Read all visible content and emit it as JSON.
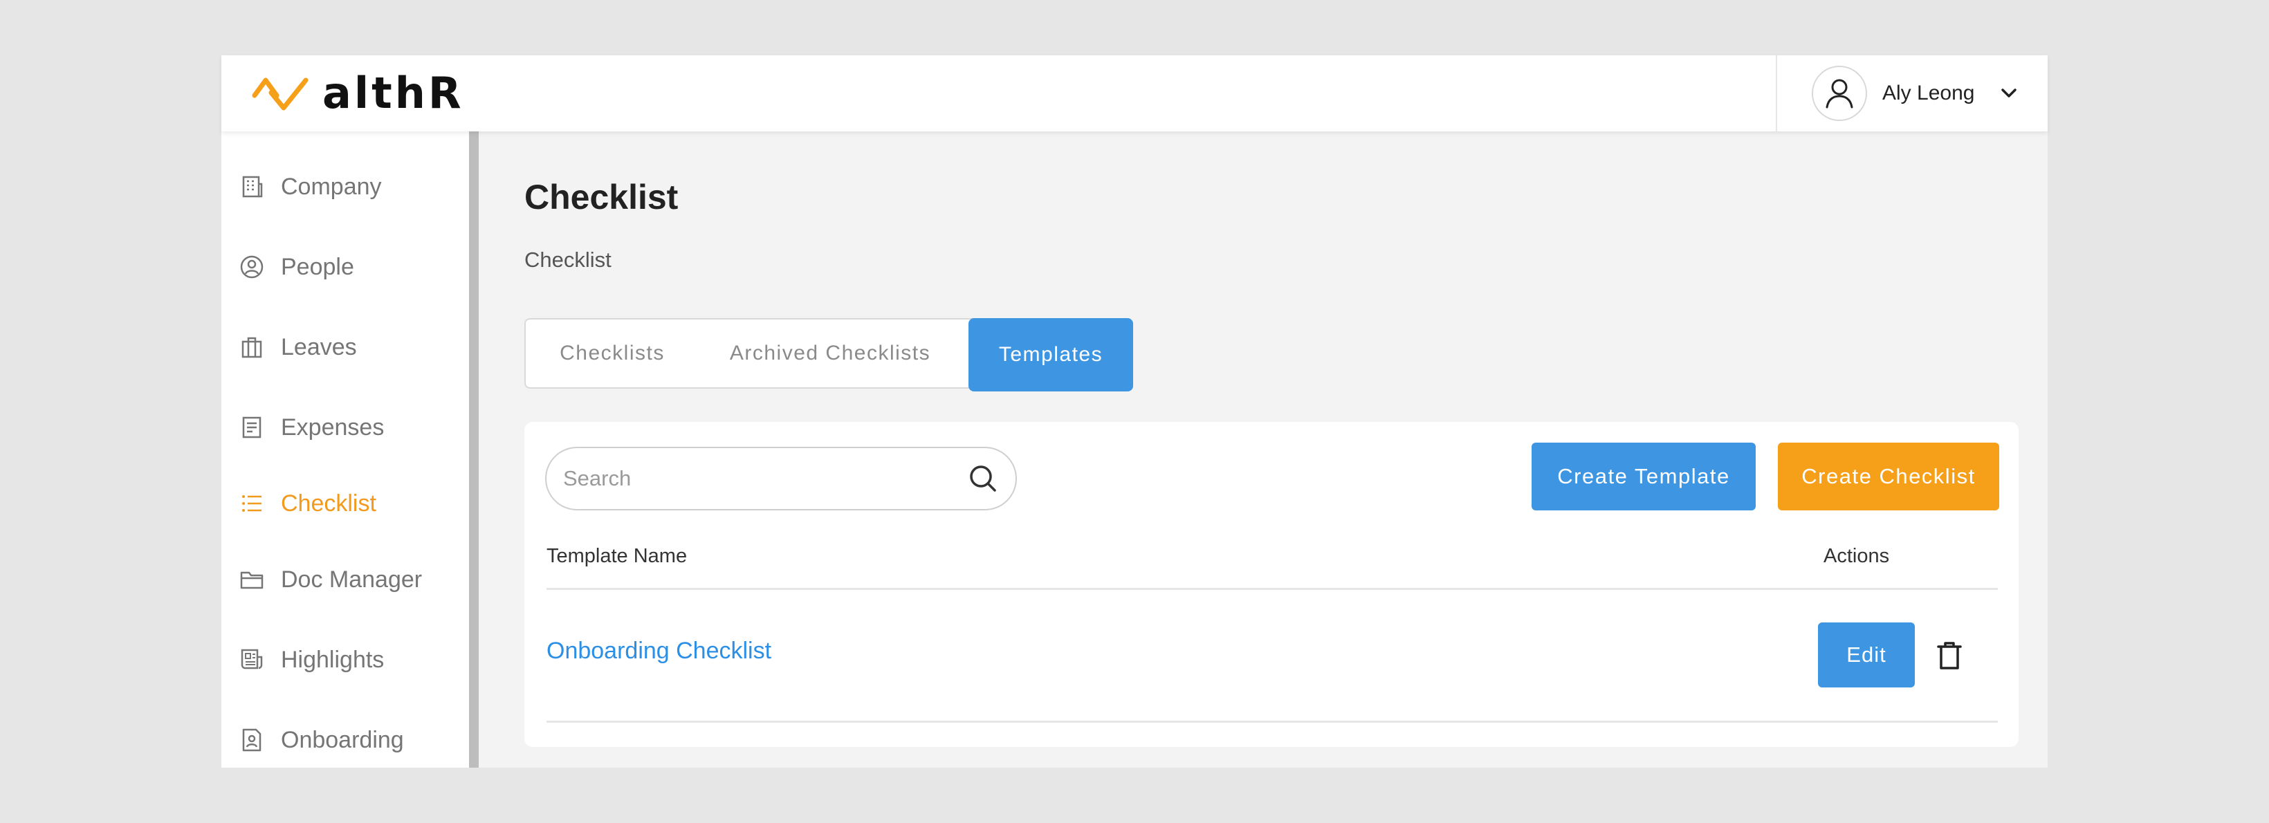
{
  "app": {
    "brand": "althR",
    "brand_colors": {
      "accent": "#f6a019",
      "primary": "#3e96e3"
    }
  },
  "header": {
    "user_name": "Aly Leong",
    "avatar_icon": "user-icon",
    "menu_icon": "chevron-down-icon"
  },
  "sidebar": {
    "items": [
      {
        "label": "Company",
        "icon": "building-icon",
        "active": false
      },
      {
        "label": "People",
        "icon": "person-circle-icon",
        "active": false
      },
      {
        "label": "Leaves",
        "icon": "suitcase-icon",
        "active": false
      },
      {
        "label": "Expenses",
        "icon": "receipt-icon",
        "active": false
      },
      {
        "label": "Checklist",
        "icon": "list-icon",
        "active": true
      },
      {
        "label": "Doc Manager",
        "icon": "folder-icon",
        "active": false
      },
      {
        "label": "Highlights",
        "icon": "newspaper-icon",
        "active": false
      },
      {
        "label": "Onboarding",
        "icon": "badge-icon",
        "active": false
      }
    ]
  },
  "main": {
    "title": "Checklist",
    "breadcrumb": "Checklist",
    "tabs": [
      {
        "label": "Checklists",
        "active": false
      },
      {
        "label": "Archived Checklists",
        "active": false
      },
      {
        "label": "Templates",
        "active": true
      }
    ],
    "search": {
      "placeholder": "Search",
      "value": ""
    },
    "buttons": {
      "create_template": "Create Template",
      "create_checklist": "Create Checklist"
    },
    "table": {
      "columns": [
        "Template Name",
        "Actions"
      ],
      "rows": [
        {
          "name": "Onboarding Checklist",
          "edit_label": "Edit"
        }
      ]
    }
  }
}
